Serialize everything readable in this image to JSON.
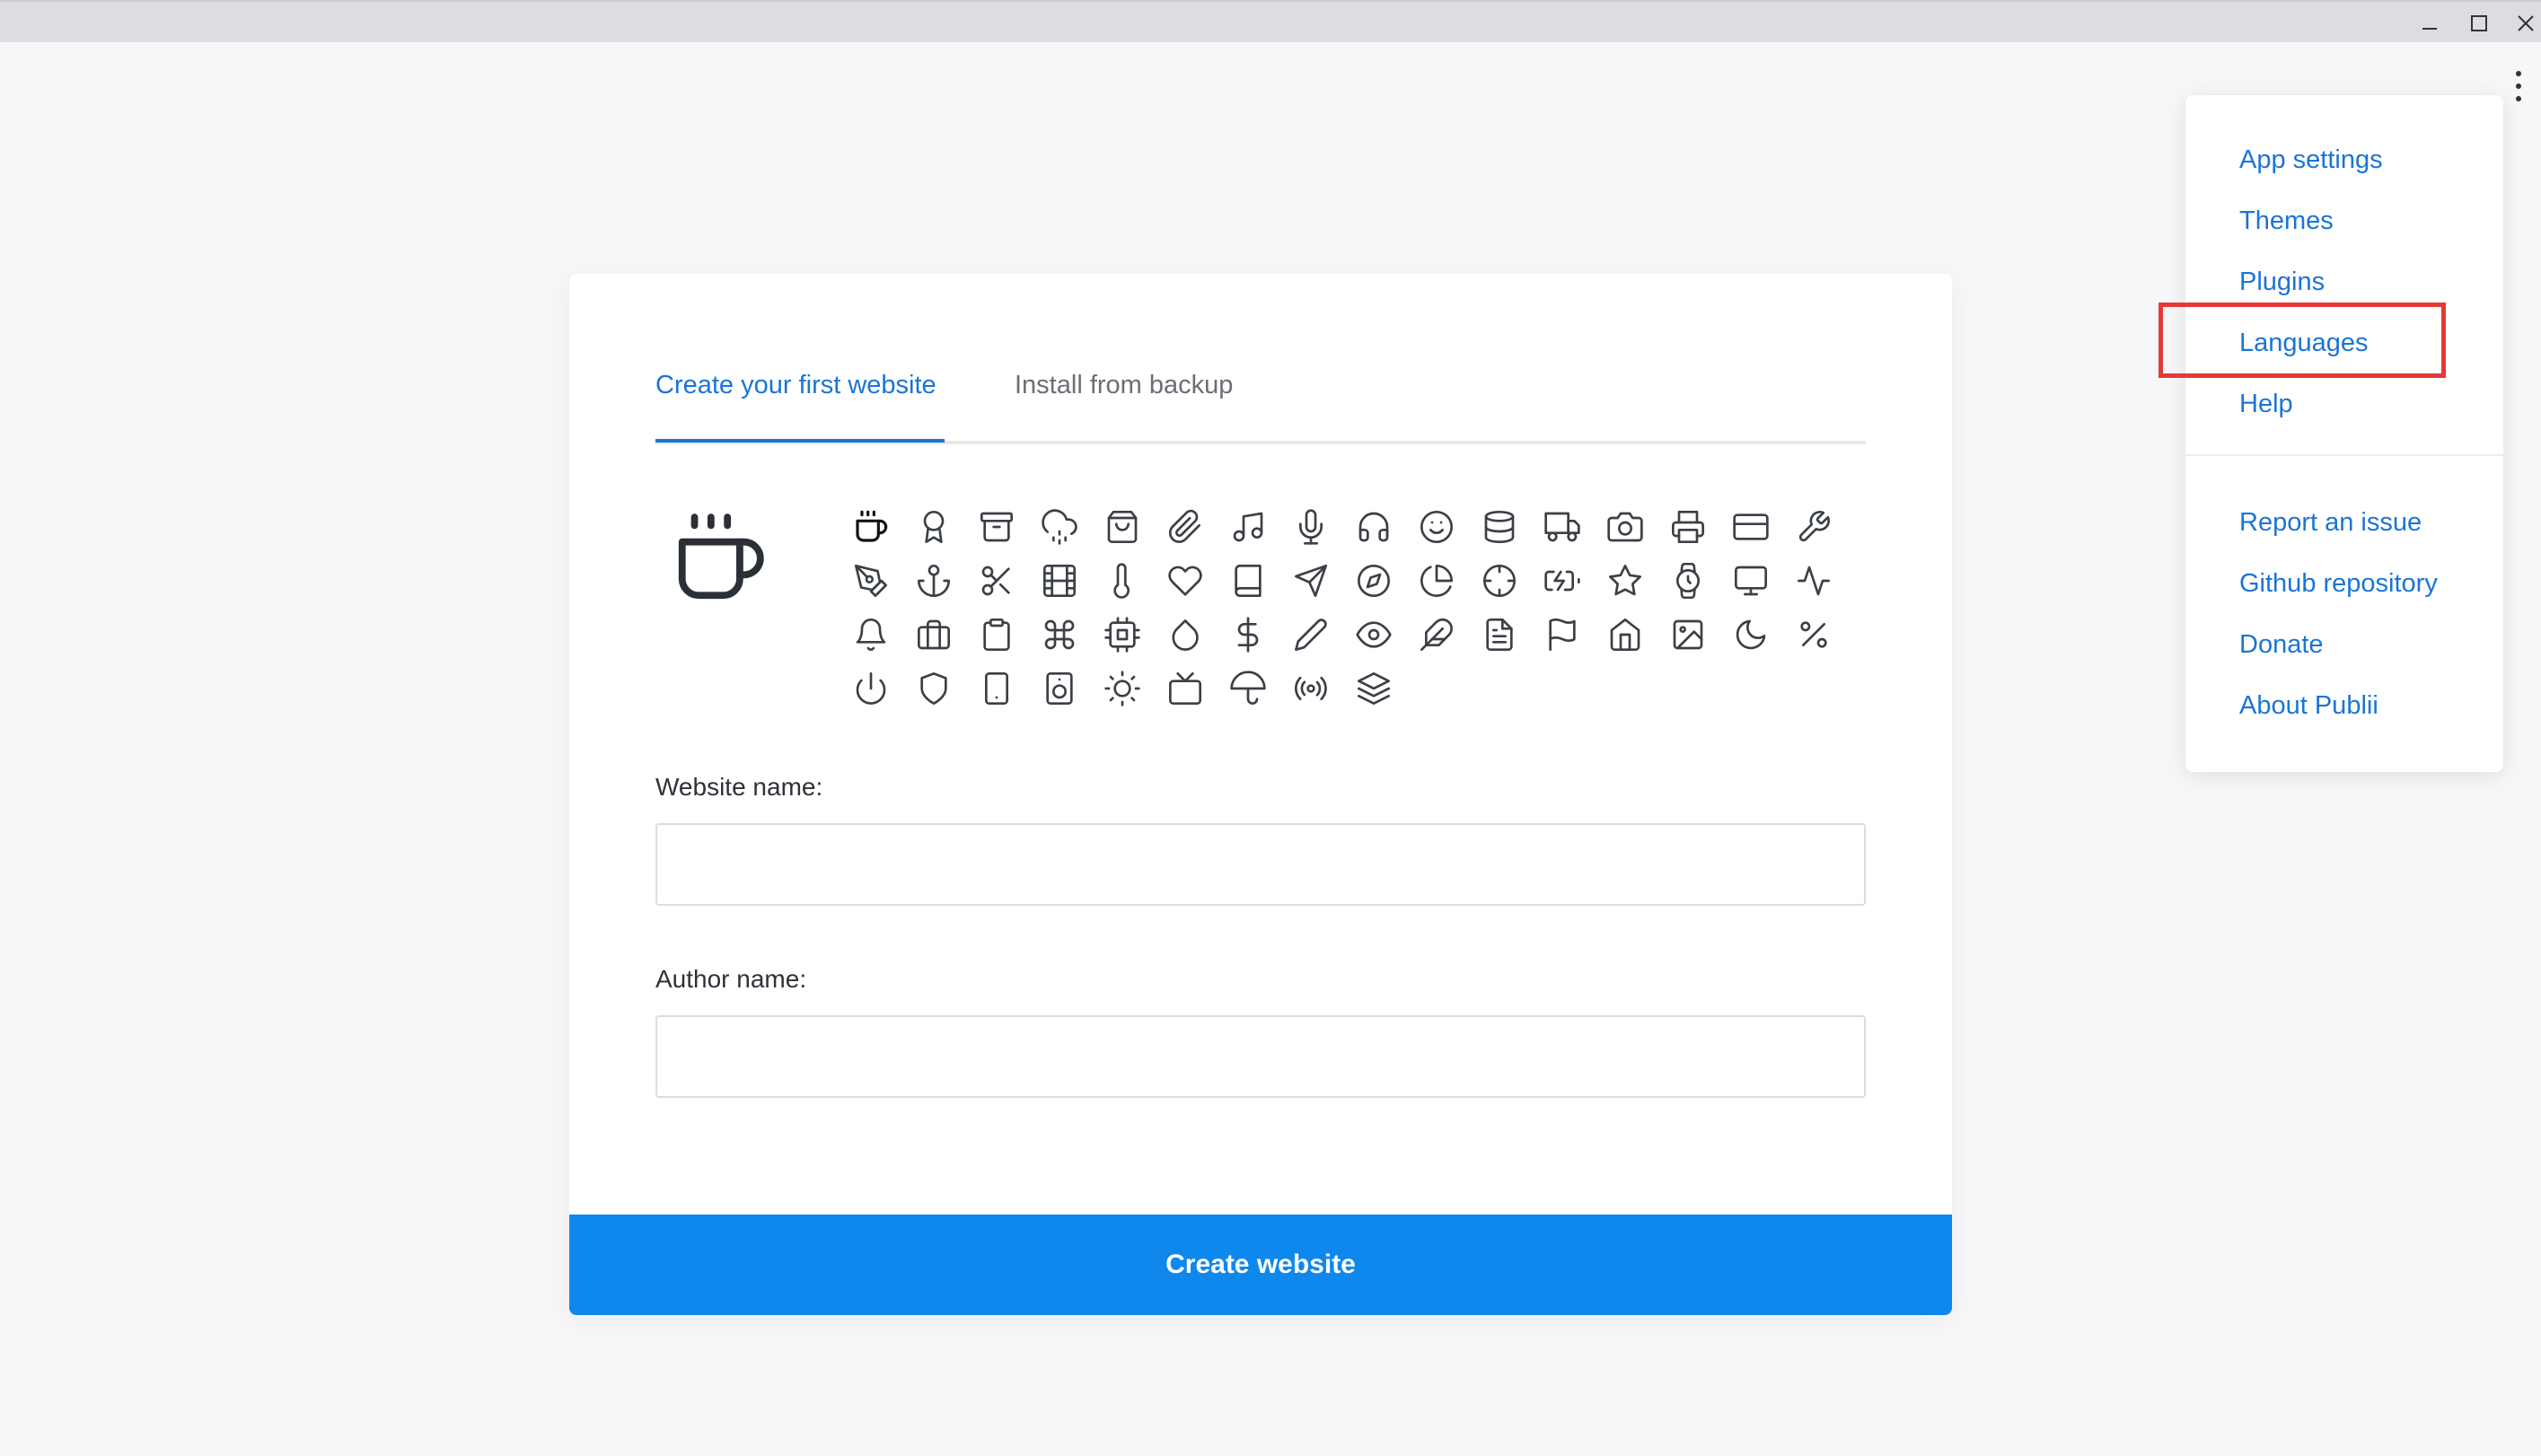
{
  "window": {
    "minimize_icon": "minimize-icon",
    "maximize_icon": "maximize-icon",
    "close_icon": "close-icon"
  },
  "menu": {
    "items": [
      {
        "label": "App settings"
      },
      {
        "label": "Themes"
      },
      {
        "label": "Plugins"
      },
      {
        "label": "Languages",
        "highlighted": true
      },
      {
        "label": "Help"
      },
      {
        "label": "Report an issue"
      },
      {
        "label": "Github repository"
      },
      {
        "label": "Donate"
      },
      {
        "label": "About Publii"
      }
    ]
  },
  "tabs": [
    {
      "label": "Create your first website",
      "active": true
    },
    {
      "label": "Install from backup",
      "active": false
    }
  ],
  "selected_icon": "coffee-icon",
  "icons": [
    "coffee",
    "award",
    "archive",
    "cloud-drizzle",
    "shopping-bag",
    "paperclip",
    "music",
    "microphone",
    "headphones",
    "smile",
    "database",
    "truck",
    "camera",
    "printer",
    "credit-card",
    "tool",
    "pen-tool",
    "anchor",
    "scissors",
    "film",
    "thermometer",
    "heart",
    "book",
    "send",
    "compass",
    "pie-chart",
    "crosshair",
    "battery-charging",
    "star",
    "watch",
    "monitor",
    "activity",
    "bell",
    "briefcase",
    "clipboard",
    "command",
    "cpu",
    "droplet",
    "dollar-sign",
    "pencil",
    "eye",
    "feather",
    "file-text",
    "flag",
    "home",
    "image",
    "moon",
    "percent",
    "power",
    "shield",
    "tablet",
    "speaker",
    "sun",
    "tv",
    "umbrella",
    "radio",
    "layers"
  ],
  "form": {
    "website_label": "Website name:",
    "website_value": "",
    "author_label": "Author name:",
    "author_value": "",
    "submit_label": "Create website"
  },
  "colors": {
    "accent": "#1b74d6",
    "button": "#0f88ee",
    "highlight": "#e53935"
  }
}
